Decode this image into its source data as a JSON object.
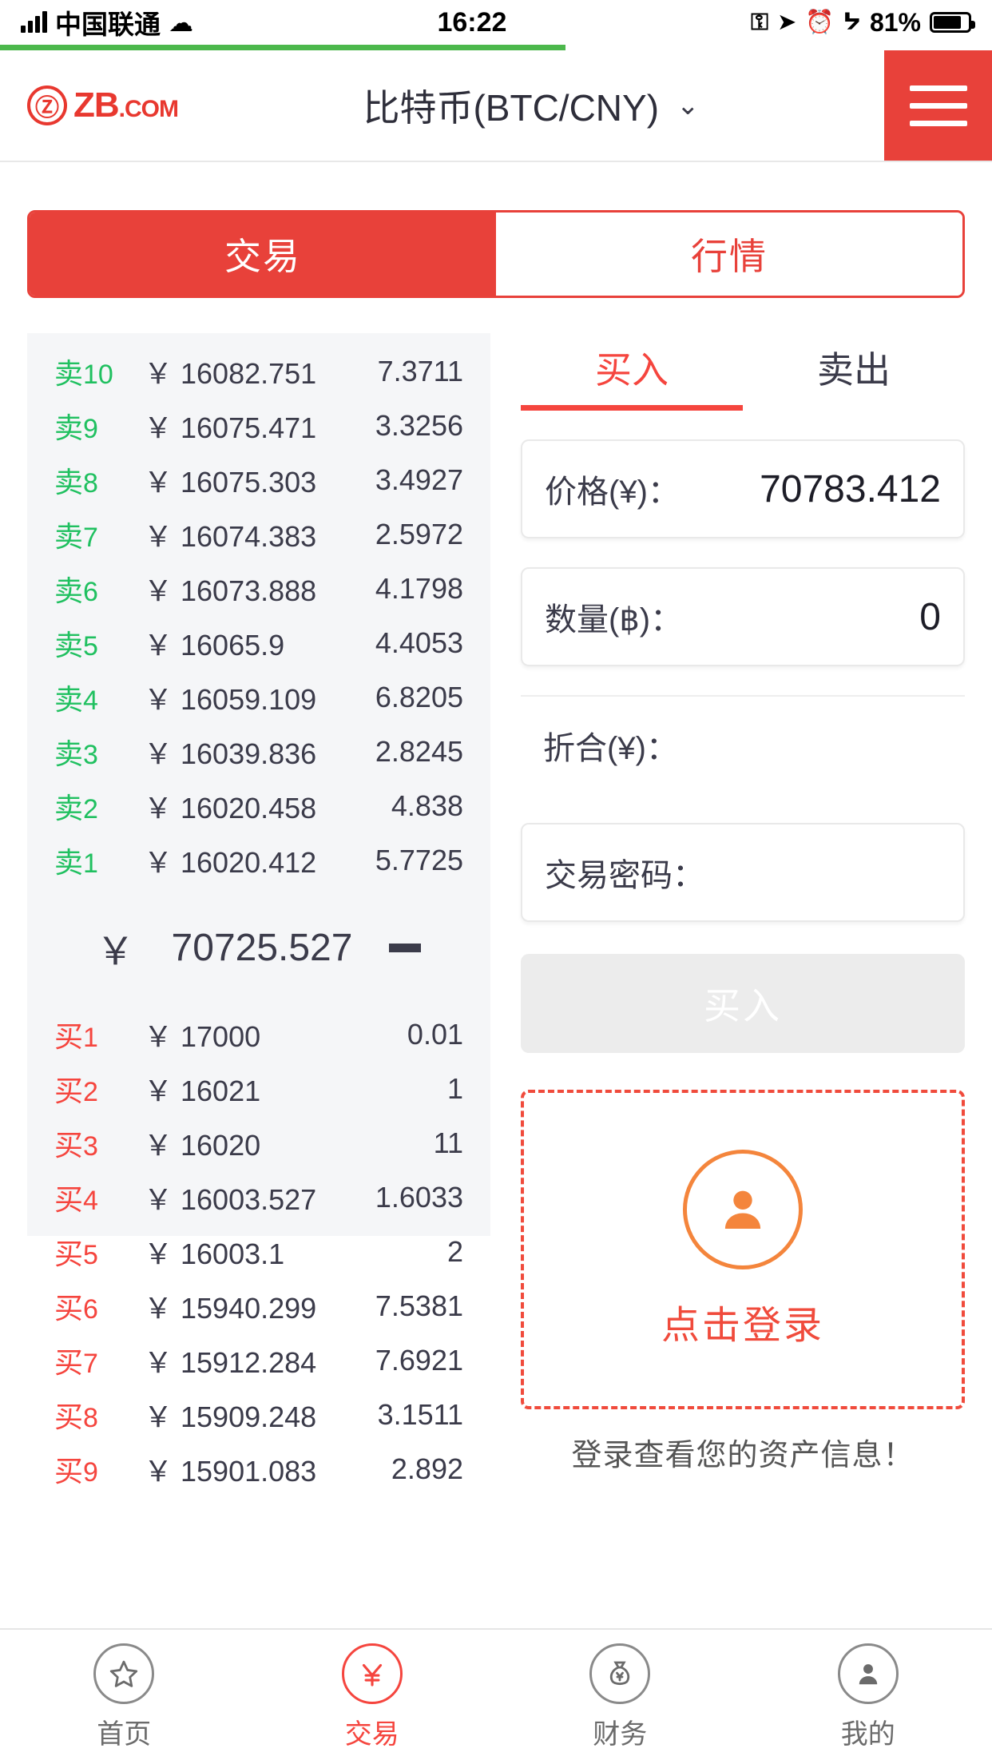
{
  "statusbar": {
    "carrier": "中国联通",
    "time": "16:22",
    "battery_percent": "81%",
    "icons": [
      "signal-bars-icon",
      "wifi-icon",
      "rotation-lock-icon",
      "location-arrow-icon",
      "alarm-clock-icon",
      "bluetooth-icon",
      "battery-icon"
    ]
  },
  "header": {
    "logo_mark": "Ⓩ",
    "logo_text": "ZB",
    "logo_suffix": ".COM",
    "pair_title": "比特币(BTC/CNY)",
    "chevron": "⌄",
    "menu_icon": "hamburger-menu-icon"
  },
  "main_tabs": [
    {
      "label": "交易",
      "active": true
    },
    {
      "label": "行情",
      "active": false
    }
  ],
  "orderbook": {
    "currency_symbol": "￥",
    "sells": [
      {
        "label": "卖",
        "n": "10",
        "price": "16082.751",
        "amount": "7.3711"
      },
      {
        "label": "卖",
        "n": "9",
        "price": "16075.471",
        "amount": "3.3256"
      },
      {
        "label": "卖",
        "n": "8",
        "price": "16075.303",
        "amount": "3.4927"
      },
      {
        "label": "卖",
        "n": "7",
        "price": "16074.383",
        "amount": "2.5972"
      },
      {
        "label": "卖",
        "n": "6",
        "price": "16073.888",
        "amount": "4.1798"
      },
      {
        "label": "卖",
        "n": "5",
        "price": "16065.9",
        "amount": "4.4053"
      },
      {
        "label": "卖",
        "n": "4",
        "price": "16059.109",
        "amount": "6.8205"
      },
      {
        "label": "卖",
        "n": "3",
        "price": "16039.836",
        "amount": "2.8245"
      },
      {
        "label": "卖",
        "n": "2",
        "price": "16020.458",
        "amount": "4.838"
      },
      {
        "label": "卖",
        "n": "1",
        "price": "16020.412",
        "amount": "5.7725"
      }
    ],
    "mid_price": "70725.527",
    "mid_trend": "flat",
    "buys": [
      {
        "label": "买",
        "n": "1",
        "price": "17000",
        "amount": "0.01"
      },
      {
        "label": "买",
        "n": "2",
        "price": "16021",
        "amount": "1"
      },
      {
        "label": "买",
        "n": "3",
        "price": "16020",
        "amount": "11"
      },
      {
        "label": "买",
        "n": "4",
        "price": "16003.527",
        "amount": "1.6033"
      },
      {
        "label": "买",
        "n": "5",
        "price": "16003.1",
        "amount": "2"
      },
      {
        "label": "买",
        "n": "6",
        "price": "15940.299",
        "amount": "7.5381"
      },
      {
        "label": "买",
        "n": "7",
        "price": "15912.284",
        "amount": "7.6921"
      },
      {
        "label": "买",
        "n": "8",
        "price": "15909.248",
        "amount": "3.1511"
      },
      {
        "label": "买",
        "n": "9",
        "price": "15901.083",
        "amount": "2.892"
      }
    ]
  },
  "trade_form": {
    "tabs": [
      {
        "label": "买入",
        "active": true
      },
      {
        "label": "卖出",
        "active": false
      }
    ],
    "price_label": "价格(¥)：",
    "price_value": "70783.412",
    "amount_label": "数量(฿)：",
    "amount_value": "0",
    "total_label": "折合(¥)：",
    "total_value": "",
    "password_label": "交易密码：",
    "password_value": "",
    "submit_label": "买入"
  },
  "login_prompt": {
    "icon": "user-avatar-icon",
    "text": "点击登录",
    "note": "登录查看您的资产信息！"
  },
  "bottom_nav": [
    {
      "label": "首页",
      "icon": "star-icon",
      "glyph": "☆",
      "active": false
    },
    {
      "label": "交易",
      "icon": "trade-yuan-icon",
      "glyph": "¥",
      "active": true
    },
    {
      "label": "财务",
      "icon": "money-bag-icon",
      "glyph": "¥",
      "active": false
    },
    {
      "label": "我的",
      "icon": "person-icon",
      "glyph": "👤",
      "active": false
    }
  ],
  "colors": {
    "brand_red": "#e8413a",
    "sell_green": "#20c060",
    "buy_red": "#f5453e",
    "panel_bg": "#f5f6f8"
  }
}
